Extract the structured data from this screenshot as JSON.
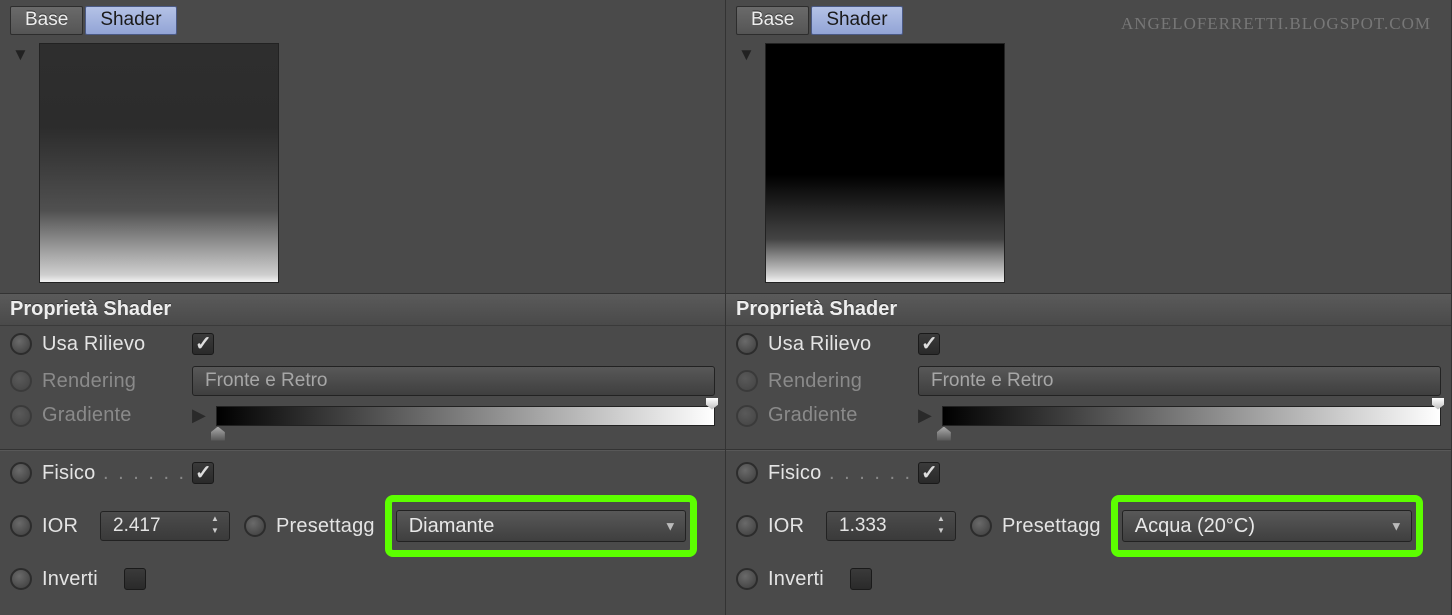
{
  "watermark": "ANGELOFERRETTI.BLOGSPOT.COM",
  "tabs": {
    "base": "Base",
    "shader": "Shader"
  },
  "section_title": "Proprietà Shader",
  "labels": {
    "usa_rilievo": "Usa Rilievo",
    "rendering": "Rendering",
    "gradiente": "Gradiente",
    "fisico": "Fisico",
    "ior": "IOR",
    "presettagg": "Presettagg",
    "inverti": "Inverti"
  },
  "rendering_value": "Fronte e Retro",
  "left": {
    "ior": "2.417",
    "preset": "Diamante"
  },
  "right": {
    "ior": "1.333",
    "preset": "Acqua (20°C)"
  }
}
